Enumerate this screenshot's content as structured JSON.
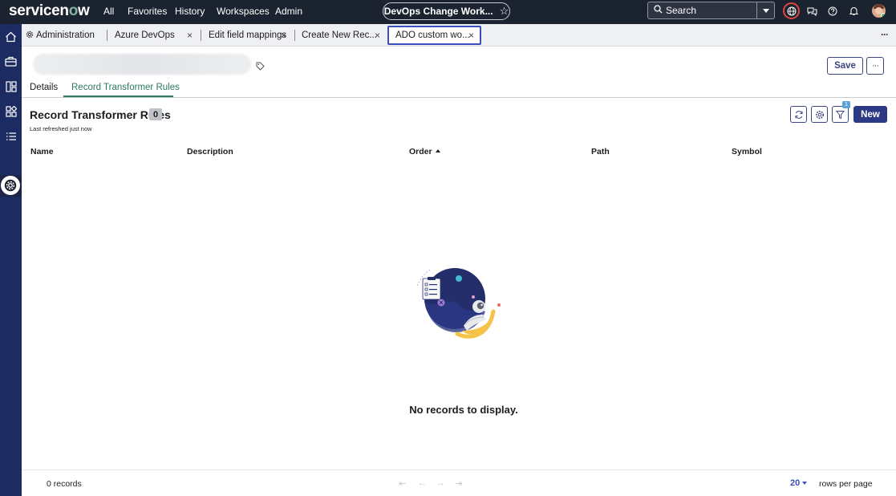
{
  "topnav": {
    "logo": "servicenow",
    "items": [
      "All",
      "Favorites",
      "History",
      "Workspaces",
      "Admin"
    ],
    "center_pill": "DevOps Change Work...",
    "search_placeholder": "Search"
  },
  "tabs": [
    {
      "label": "Administration",
      "icon": "gear-icon"
    },
    {
      "label": "Azure DevOps"
    },
    {
      "label": "Edit field mappings"
    },
    {
      "label": "Create New Rec..."
    },
    {
      "label": "ADO custom wo...",
      "active": true
    }
  ],
  "record": {
    "save_label": "Save",
    "subtabs": [
      "Details",
      "Record Transformer Rules"
    ],
    "active_subtab": "Record Transformer Rules"
  },
  "list": {
    "title": "Record Transformer Rules",
    "count": "0",
    "refreshed": "Last refreshed just now",
    "filter_count": "1",
    "new_label": "New",
    "columns": [
      "Name",
      "Description",
      "Order",
      "Path",
      "Symbol"
    ],
    "sorted_column": "Order",
    "empty_message": "No records to display."
  },
  "footer": {
    "records": "0 records",
    "rows_per_page": "20",
    "rows_per_page_label": "rows per page"
  },
  "colors": {
    "accent": "#3d4dc1",
    "primary_button": "#2c3a86",
    "active_tab_text": "#2a7a5e",
    "topbar": "#1c2330",
    "sidebar": "#1c2c63"
  }
}
